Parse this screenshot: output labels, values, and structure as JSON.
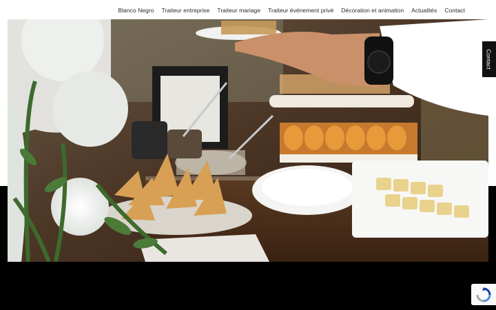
{
  "nav": {
    "items": [
      {
        "label": "Blanco Negro",
        "name": "nav-item-blanco-negro"
      },
      {
        "label": "Traiteur entreprise",
        "name": "nav-item-traiteur-entreprise"
      },
      {
        "label": "Traiteur mariage",
        "name": "nav-item-traiteur-mariage"
      },
      {
        "label": "Traiteur événement privé",
        "name": "nav-item-traiteur-evenement-prive"
      },
      {
        "label": "Décoration et animation",
        "name": "nav-item-decoration-animation"
      },
      {
        "label": "Actualités",
        "name": "nav-item-actualites"
      },
      {
        "label": "Contact",
        "name": "nav-item-contact"
      }
    ]
  },
  "side_tab": {
    "label": "Contact"
  },
  "hero": {
    "icon": "catering-buffet-photo"
  },
  "recaptcha": {
    "icon": "recaptcha-icon"
  }
}
